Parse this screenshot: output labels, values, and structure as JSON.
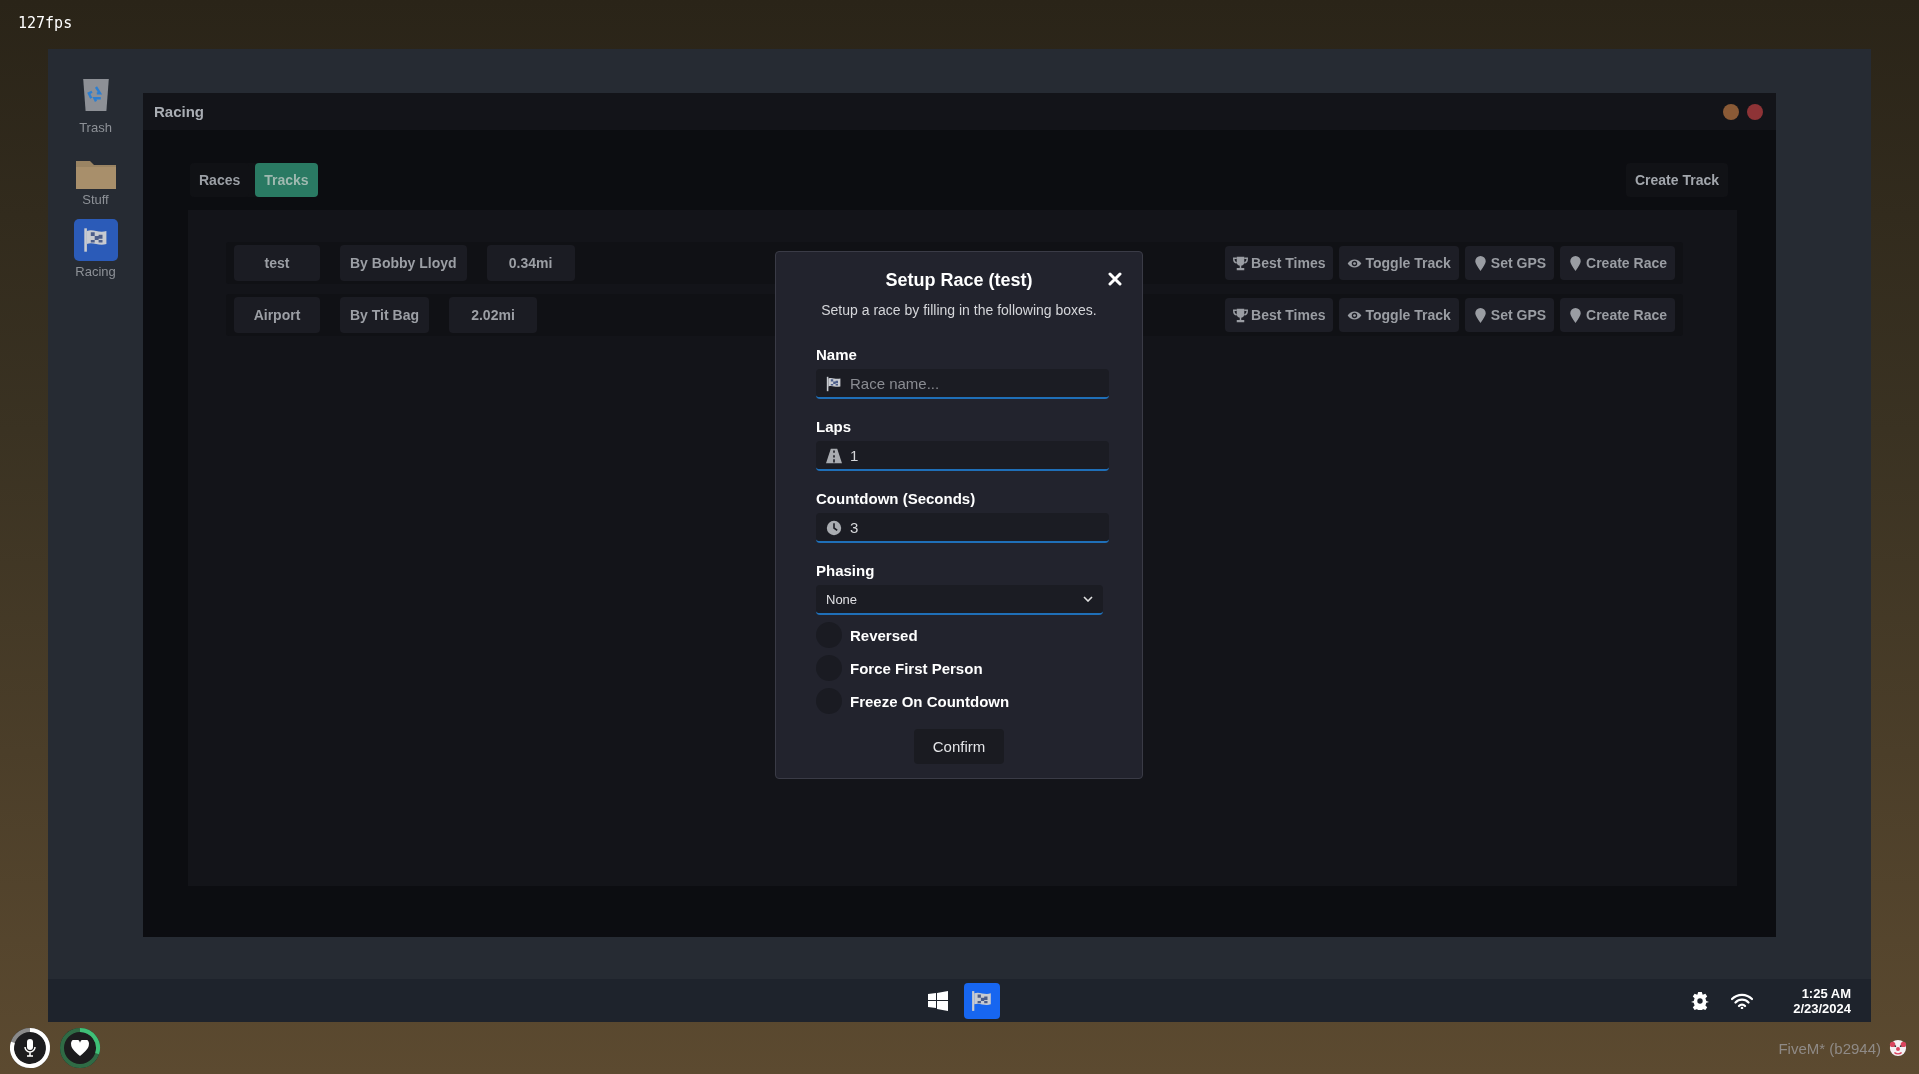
{
  "overlay": {
    "fps": "127fps",
    "build": "FiveM* (b2944)"
  },
  "desktop_icons": [
    {
      "kind": "trash",
      "label": "Trash"
    },
    {
      "kind": "folder",
      "label": "Stuff"
    },
    {
      "kind": "racing",
      "label": "Racing"
    }
  ],
  "window": {
    "title": "Racing",
    "tabs": [
      {
        "label": "Races",
        "selected": false
      },
      {
        "label": "Tracks",
        "selected": true
      }
    ],
    "create_button": "Create Track",
    "tracks": [
      {
        "name": "test",
        "author": "By Bobby Lloyd",
        "distance": "0.34mi",
        "actions": [
          {
            "kind": "trophy",
            "label": "Best Times"
          },
          {
            "kind": "eye",
            "label": "Toggle Track"
          },
          {
            "kind": "pin",
            "label": "Set GPS"
          },
          {
            "kind": "pin",
            "label": "Create Race"
          }
        ]
      },
      {
        "name": "Airport",
        "author": "By Tit Bag",
        "distance": "2.02mi",
        "actions": [
          {
            "kind": "trophy",
            "label": "Best Times"
          },
          {
            "kind": "eye",
            "label": "Toggle Track"
          },
          {
            "kind": "pin",
            "label": "Set GPS"
          },
          {
            "kind": "pin",
            "label": "Create Race"
          }
        ]
      }
    ]
  },
  "dialog": {
    "title": "Setup Race (test)",
    "subtitle": "Setup a race by filling in the following boxes.",
    "fields": [
      {
        "kind": "name",
        "label": "Name",
        "placeholder": "Race name..."
      },
      {
        "kind": "laps",
        "label": "Laps",
        "value": "1"
      },
      {
        "kind": "countdown",
        "label": "Countdown (Seconds)",
        "value": "3"
      },
      {
        "kind": "select",
        "label": "Phasing",
        "value": "None"
      }
    ],
    "toggles": [
      {
        "label": "Reversed",
        "checked": false
      },
      {
        "label": "Force First Person",
        "checked": false
      },
      {
        "label": "Freeze On Countdown",
        "checked": false
      }
    ],
    "confirm": "Confirm"
  },
  "taskbar": {
    "apps": [
      {
        "kind": "start"
      },
      {
        "kind": "racing"
      }
    ],
    "time": "1:25 AM",
    "date": "2/23/2024"
  },
  "hud": [
    {
      "kind": "voice"
    },
    {
      "kind": "health"
    }
  ]
}
